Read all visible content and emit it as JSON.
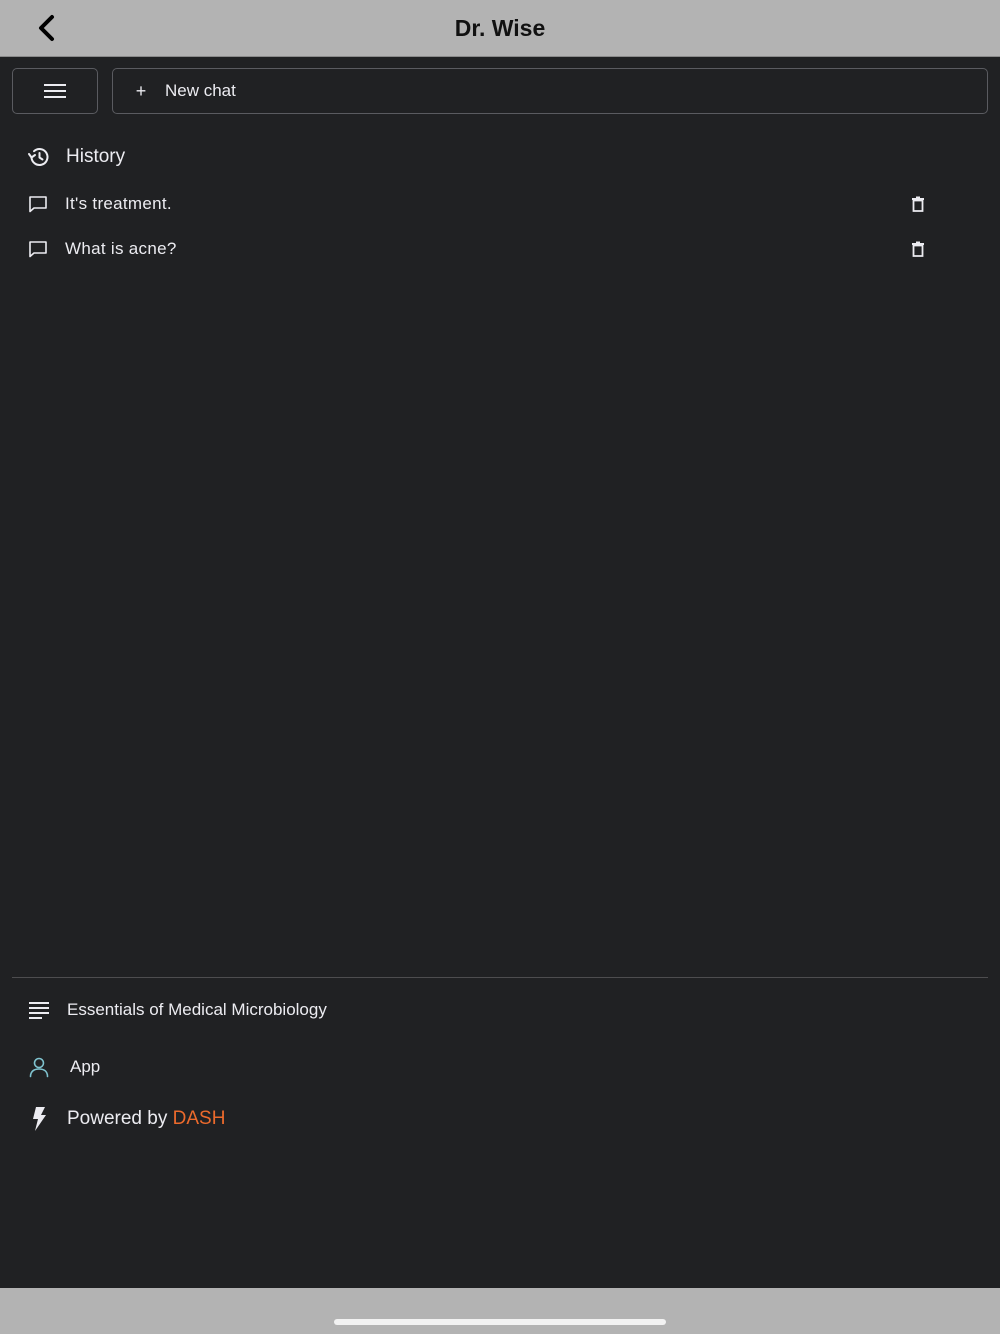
{
  "header": {
    "title": "Dr. Wise"
  },
  "toolbar": {
    "new_chat_plus": "+",
    "new_chat_label": "New chat"
  },
  "history": {
    "title": "History",
    "items": [
      {
        "label": "It's treatment."
      },
      {
        "label": "What is acne?"
      }
    ]
  },
  "footer": {
    "book_label": "Essentials of Medical Microbiology",
    "app_label": "App",
    "powered_prefix": "Powered by ",
    "powered_brand": "DASH"
  },
  "colors": {
    "background": "#202123",
    "bars": "#b3b3b3",
    "brand_accent": "#ec6a2c",
    "user_icon": "#7fc3cf"
  },
  "icons": {
    "back": "chevron-left-icon",
    "menu": "hamburger-menu-icon",
    "history": "history-icon",
    "chat": "message-icon",
    "delete": "trash-icon",
    "book": "text-lines-icon",
    "user": "user-icon",
    "bolt": "lightning-bolt-icon"
  }
}
